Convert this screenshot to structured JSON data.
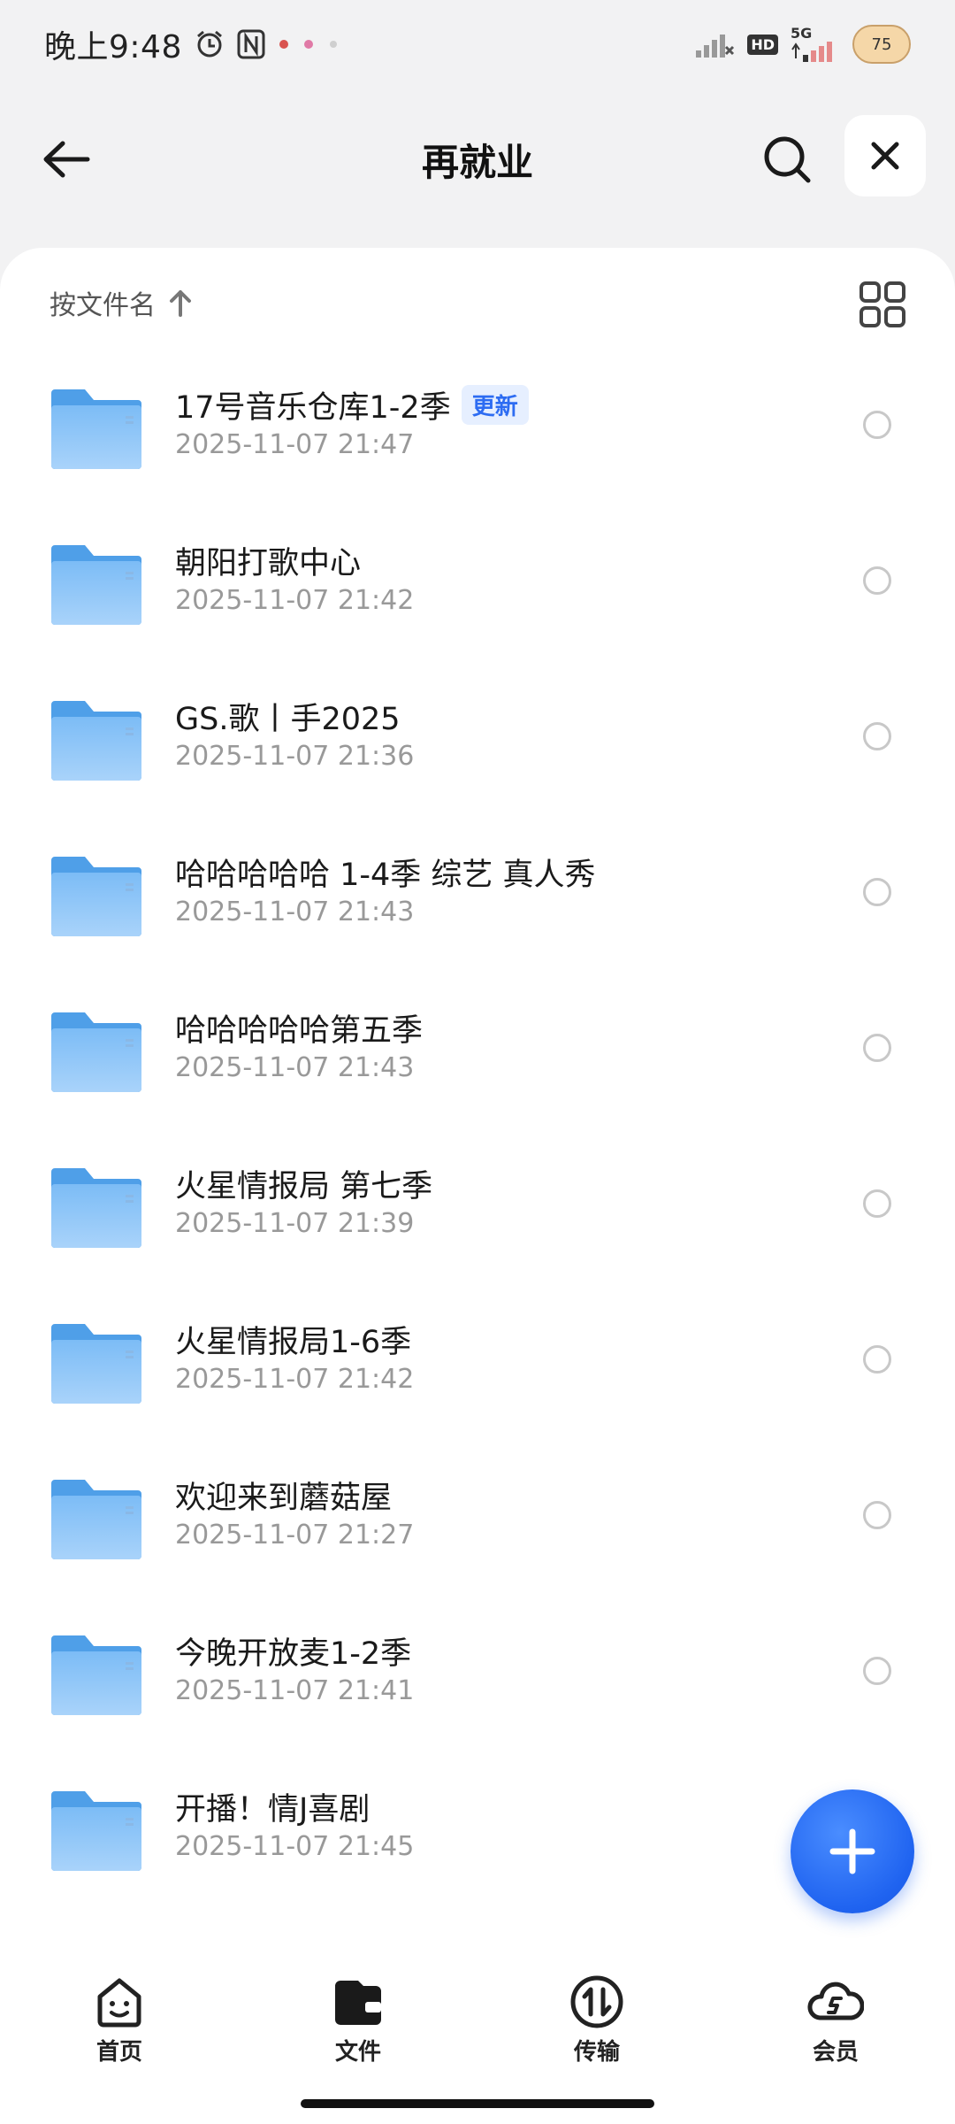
{
  "status_bar": {
    "time": "晚上9:48",
    "network": "5G",
    "hd": "HD",
    "battery": "75"
  },
  "header": {
    "title": "再就业"
  },
  "sort": {
    "label": "按文件名"
  },
  "files": [
    {
      "name": "17号音乐仓库1-2季",
      "date": "2025-11-07 21:47",
      "badge": "更新"
    },
    {
      "name": "朝阳打歌中心",
      "date": "2025-11-07 21:42"
    },
    {
      "name": "GS.歌丨手2025",
      "date": "2025-11-07 21:36"
    },
    {
      "name": "哈哈哈哈哈 1-4季 综艺 真人秀",
      "date": "2025-11-07 21:43"
    },
    {
      "name": "哈哈哈哈哈第五季",
      "date": "2025-11-07 21:43"
    },
    {
      "name": "火星情报局 第七季",
      "date": "2025-11-07 21:39"
    },
    {
      "name": "火星情报局1-6季",
      "date": "2025-11-07 21:42"
    },
    {
      "name": "欢迎来到蘑菇屋",
      "date": "2025-11-07 21:27"
    },
    {
      "name": "今晚开放麦1-2季",
      "date": "2025-11-07 21:41"
    },
    {
      "name": "开播！情J喜剧",
      "date": "2025-11-07 21:45"
    }
  ],
  "nav": {
    "home": "首页",
    "files": "文件",
    "transfer": "传输",
    "vip": "会员"
  },
  "colors": {
    "accent": "#1f63f0",
    "folder": "#5aa9f0",
    "badge_bg": "#e6efff"
  }
}
